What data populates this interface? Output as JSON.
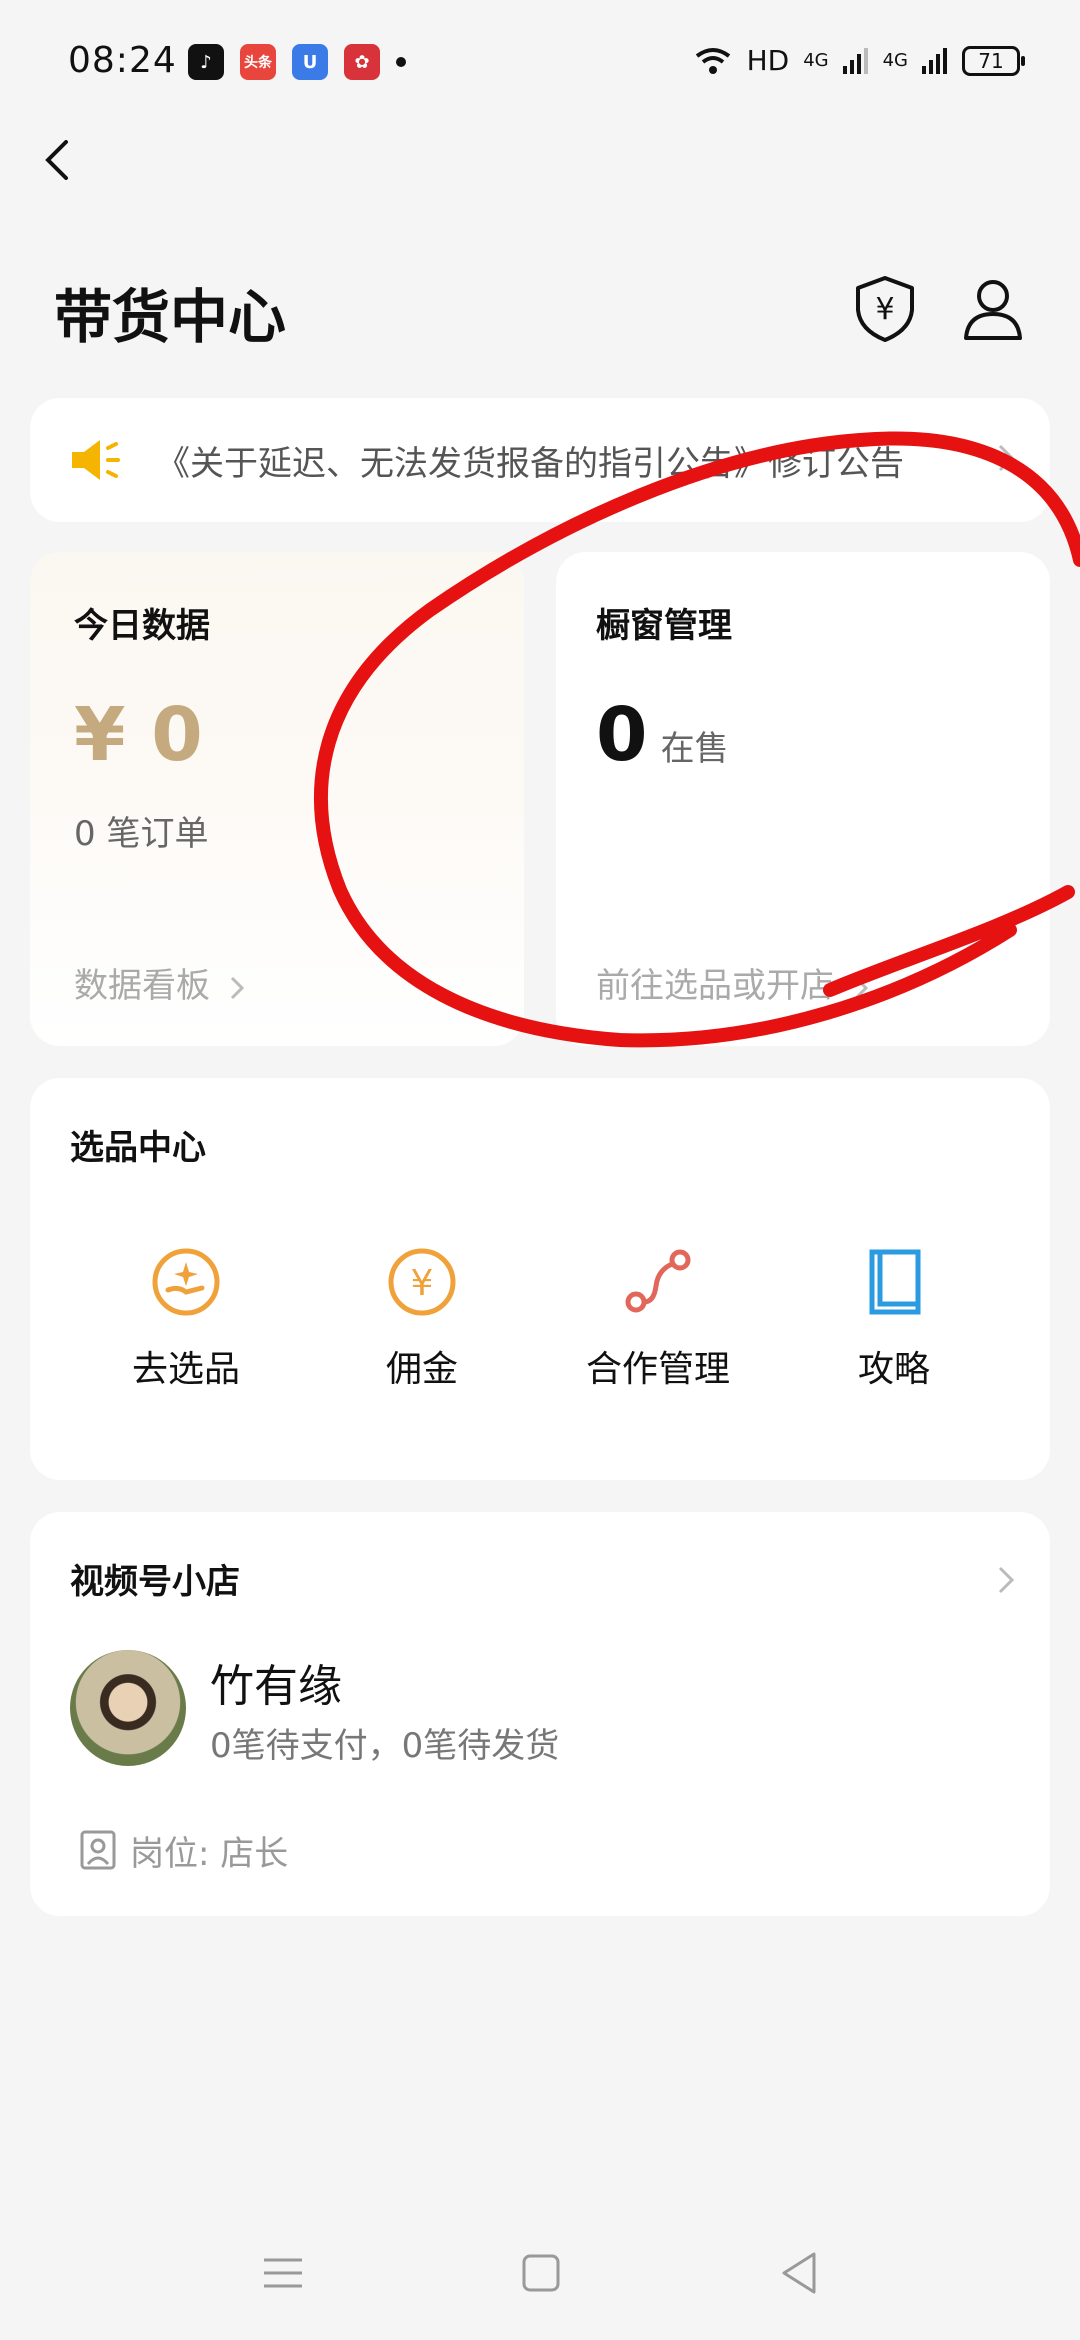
{
  "status_bar": {
    "time": "08:24",
    "network": "HD",
    "signal_1": "4G",
    "signal_2": "4G",
    "battery": "71",
    "app_icons": [
      "douyin-icon",
      "toutiao-icon",
      "app-u-icon",
      "app-red-icon"
    ]
  },
  "header": {
    "title": "带货中心"
  },
  "notice": {
    "text": "《关于延迟、无法发货报备的指引公告》修订公告"
  },
  "today": {
    "title": "今日数据",
    "currency": "¥",
    "amount": "0",
    "orders": "0 笔订单",
    "link": "数据看板"
  },
  "window": {
    "title": "橱窗管理",
    "count": "0",
    "count_label": "在售",
    "link": "前往选品或开店"
  },
  "pick_center": {
    "title": "选品中心",
    "items": [
      {
        "label": "去选品",
        "icon": "hand-sparkle-icon"
      },
      {
        "label": "佣金",
        "icon": "yen-coin-icon"
      },
      {
        "label": "合作管理",
        "icon": "route-icon"
      },
      {
        "label": "攻略",
        "icon": "book-icon"
      }
    ]
  },
  "shop": {
    "title": "视频号小店",
    "name": "竹有缘",
    "status": "0笔待支付，0笔待发货",
    "role": "岗位: 店长"
  },
  "colors": {
    "accent_gold": "#c5aa7f",
    "orange_icon": "#f0a13a",
    "red_icon": "#e2675a",
    "blue_icon": "#2a9be0",
    "annotation_red": "#e61212"
  }
}
